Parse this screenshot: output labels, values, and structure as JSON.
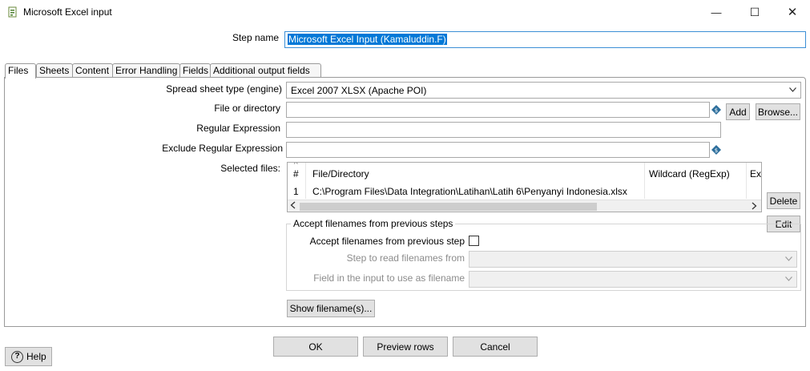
{
  "window": {
    "title": "Microsoft Excel input",
    "minimize_glyph": "—",
    "maximize_glyph": "☐",
    "close_glyph": "✕"
  },
  "step": {
    "label": "Step name",
    "value": "Microsoft Excel Input (Kamaluddin.F)"
  },
  "tabs": [
    {
      "label": "Files",
      "active": true
    },
    {
      "label": "Sheets"
    },
    {
      "label": "Content"
    },
    {
      "label": "Error Handling"
    },
    {
      "label": "Fields"
    },
    {
      "label": "Additional output fields"
    }
  ],
  "files": {
    "spreadsheet_type_label": "Spread sheet type (engine)",
    "spreadsheet_type_value": "Excel 2007 XLSX (Apache POI)",
    "file_or_directory_label": "File or directory",
    "file_or_directory_value": "",
    "add_label": "Add",
    "browse_label": "Browse...",
    "regex_label": "Regular Expression",
    "regex_value": "",
    "exclude_regex_label": "Exclude Regular Expression",
    "exclude_regex_value": "",
    "selected_files_label": "Selected files:",
    "table": {
      "sort_glyph": "^",
      "headers": [
        "#",
        "File/Directory",
        "Wildcard (RegExp)",
        "Exc"
      ],
      "rows": [
        [
          "1",
          "C:\\Program Files\\Data Integration\\Latihan\\Latih 6\\Penyanyi Indonesia.xlsx",
          "",
          ""
        ]
      ]
    },
    "delete_label": "Delete",
    "edit_label": "Edit",
    "accept_group_title": "Accept filenames from previous steps",
    "accept_checkbox_label": "Accept filenames from previous step",
    "accept_checked": false,
    "step_to_read_label": "Step to read filenames from",
    "step_to_read_value": "",
    "field_in_input_label": "Field in the input to use as filename",
    "field_in_input_value": "",
    "show_filenames_label": "Show filename(s)..."
  },
  "footer": {
    "help_label": "Help",
    "ok_label": "OK",
    "preview_label": "Preview rows",
    "cancel_label": "Cancel"
  },
  "colors": {
    "selection": "#0078d7",
    "step_border": "#3c8fd6",
    "variable_icon": "#2c6e9c"
  }
}
